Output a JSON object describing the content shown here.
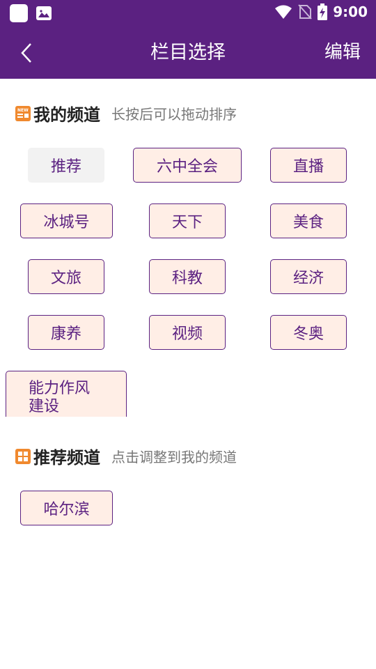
{
  "status_bar": {
    "time": "9:00"
  },
  "header": {
    "title": "栏目选择",
    "edit_label": "编辑"
  },
  "my_channels": {
    "title": "我的频道",
    "hint": "长按后可以拖动排序",
    "items": [
      "推荐",
      "六中全会",
      "直播",
      "冰城号",
      "天下",
      "美食",
      "文旅",
      "科教",
      "经济",
      "康养",
      "视频",
      "冬奥",
      "能力作风建设"
    ],
    "selected": "推荐"
  },
  "recommended_channels": {
    "title": "推荐频道",
    "hint": "点击调整到我的频道",
    "items": [
      "哈尔滨"
    ]
  },
  "colors": {
    "brand": "#5b2181",
    "chip_bg": "#ffeee6",
    "icon_orange": "#f0892e"
  }
}
